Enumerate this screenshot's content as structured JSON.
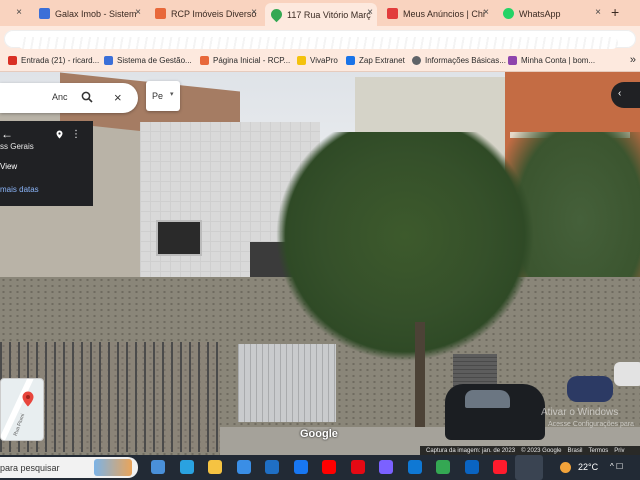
{
  "browser": {
    "tabs": [
      {
        "label": "Galax Imob - Sistem",
        "favicon_color": "#3b6fd8"
      },
      {
        "label": "RCP Imóveis Diversos",
        "favicon_color": "#e8683a"
      },
      {
        "label": "117 Rua Vitório Març",
        "favicon_color": "#34a853",
        "active": true
      },
      {
        "label": "Meus Anúncios | Chi",
        "favicon_color": "#e23c3c"
      },
      {
        "label": "WhatsApp",
        "favicon_color": "#25d366"
      }
    ],
    "close_glyph": "×",
    "new_tab_glyph": "+"
  },
  "bookmarks": [
    {
      "label": "Entrada (21) - ricard...",
      "icon": "gmail-icon",
      "color": "#d93025"
    },
    {
      "label": "Sistema de Gestão...",
      "icon": "galax-icon",
      "color": "#3b6fd8"
    },
    {
      "label": "Página Inicial - RCP...",
      "icon": "rcp-icon",
      "color": "#e8683a"
    },
    {
      "label": "VivaPro",
      "icon": "vivapro-icon",
      "color": "#f4c20d"
    },
    {
      "label": "Zap Extranet",
      "icon": "zap-icon",
      "color": "#1a73e8"
    },
    {
      "label": "Informações Básicas...",
      "icon": "globe-icon",
      "color": "#5f6368"
    },
    {
      "label": "Minha Conta | bom...",
      "icon": "bomcasa-icon",
      "color": "#8e44ad"
    }
  ],
  "bookmarks_more": "»",
  "maps": {
    "search": {
      "value": "Anc",
      "clear": "×"
    },
    "dropdown_value": "Pe",
    "dropdown_arrow": "▾",
    "info_card": {
      "back": "←",
      "region": "ss Gerais",
      "view_label": "View",
      "more_label": "mais datas"
    },
    "share_glyph": "‹",
    "minimap_label": "Rua Piumi",
    "logo": "Google",
    "watermark_line1": "Ativar o Windows",
    "watermark_line2": "Acesse Configurações para",
    "footer": [
      "Captura da imagem: jan. de 2023",
      "© 2023 Google",
      "Brasil",
      "Termos",
      "Priv"
    ]
  },
  "taskbar": {
    "search_label": "para pesquisar",
    "temperature": "22°C",
    "tray": "^ ☐"
  },
  "taskbar_icons": [
    {
      "name": "task-view-icon",
      "color": "#4a90d9"
    },
    {
      "name": "edge-icon",
      "color": "#2aa2e0"
    },
    {
      "name": "file-explorer-icon",
      "color": "#f5c342"
    },
    {
      "name": "store-icon",
      "color": "#3a8ee6"
    },
    {
      "name": "outlook-icon",
      "color": "#1f6fc5"
    },
    {
      "name": "facebook-icon",
      "color": "#1877f2"
    },
    {
      "name": "youtube-icon",
      "color": "#ff0000"
    },
    {
      "name": "netflix-icon",
      "color": "#e50914"
    },
    {
      "name": "prime-video-icon",
      "color": "#7b61ff"
    },
    {
      "name": "outlook-2-icon",
      "color": "#0f78d4"
    },
    {
      "name": "maps-icon",
      "color": "#34a853"
    },
    {
      "name": "outlook-3-icon",
      "color": "#0a64c2"
    },
    {
      "name": "opera-icon",
      "color": "#ff1b2d"
    },
    {
      "name": "chrome-icon",
      "color": "#fbbc05"
    }
  ]
}
